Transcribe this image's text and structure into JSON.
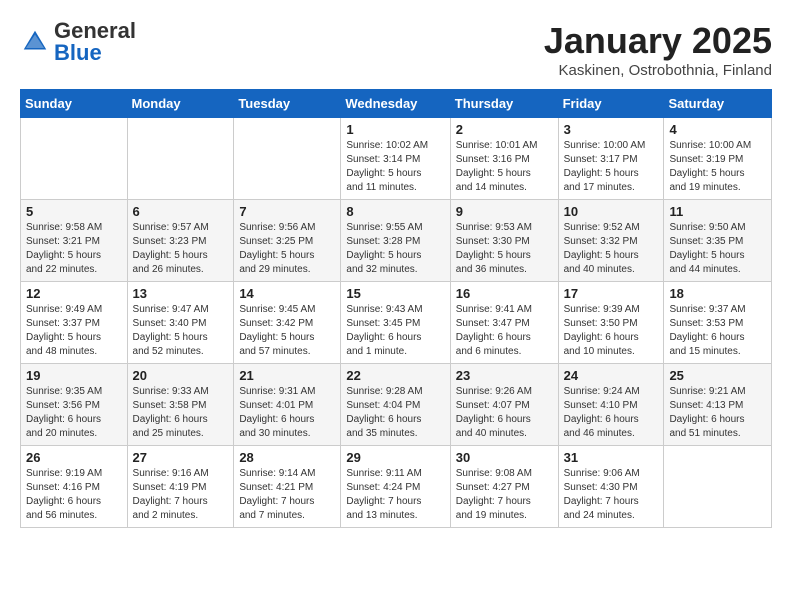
{
  "header": {
    "logo_general": "General",
    "logo_blue": "Blue",
    "month_title": "January 2025",
    "location": "Kaskinen, Ostrobothnia, Finland"
  },
  "days_of_week": [
    "Sunday",
    "Monday",
    "Tuesday",
    "Wednesday",
    "Thursday",
    "Friday",
    "Saturday"
  ],
  "weeks": [
    [
      {
        "day": "",
        "info": ""
      },
      {
        "day": "",
        "info": ""
      },
      {
        "day": "",
        "info": ""
      },
      {
        "day": "1",
        "info": "Sunrise: 10:02 AM\nSunset: 3:14 PM\nDaylight: 5 hours\nand 11 minutes."
      },
      {
        "day": "2",
        "info": "Sunrise: 10:01 AM\nSunset: 3:16 PM\nDaylight: 5 hours\nand 14 minutes."
      },
      {
        "day": "3",
        "info": "Sunrise: 10:00 AM\nSunset: 3:17 PM\nDaylight: 5 hours\nand 17 minutes."
      },
      {
        "day": "4",
        "info": "Sunrise: 10:00 AM\nSunset: 3:19 PM\nDaylight: 5 hours\nand 19 minutes."
      }
    ],
    [
      {
        "day": "5",
        "info": "Sunrise: 9:58 AM\nSunset: 3:21 PM\nDaylight: 5 hours\nand 22 minutes."
      },
      {
        "day": "6",
        "info": "Sunrise: 9:57 AM\nSunset: 3:23 PM\nDaylight: 5 hours\nand 26 minutes."
      },
      {
        "day": "7",
        "info": "Sunrise: 9:56 AM\nSunset: 3:25 PM\nDaylight: 5 hours\nand 29 minutes."
      },
      {
        "day": "8",
        "info": "Sunrise: 9:55 AM\nSunset: 3:28 PM\nDaylight: 5 hours\nand 32 minutes."
      },
      {
        "day": "9",
        "info": "Sunrise: 9:53 AM\nSunset: 3:30 PM\nDaylight: 5 hours\nand 36 minutes."
      },
      {
        "day": "10",
        "info": "Sunrise: 9:52 AM\nSunset: 3:32 PM\nDaylight: 5 hours\nand 40 minutes."
      },
      {
        "day": "11",
        "info": "Sunrise: 9:50 AM\nSunset: 3:35 PM\nDaylight: 5 hours\nand 44 minutes."
      }
    ],
    [
      {
        "day": "12",
        "info": "Sunrise: 9:49 AM\nSunset: 3:37 PM\nDaylight: 5 hours\nand 48 minutes."
      },
      {
        "day": "13",
        "info": "Sunrise: 9:47 AM\nSunset: 3:40 PM\nDaylight: 5 hours\nand 52 minutes."
      },
      {
        "day": "14",
        "info": "Sunrise: 9:45 AM\nSunset: 3:42 PM\nDaylight: 5 hours\nand 57 minutes."
      },
      {
        "day": "15",
        "info": "Sunrise: 9:43 AM\nSunset: 3:45 PM\nDaylight: 6 hours\nand 1 minute."
      },
      {
        "day": "16",
        "info": "Sunrise: 9:41 AM\nSunset: 3:47 PM\nDaylight: 6 hours\nand 6 minutes."
      },
      {
        "day": "17",
        "info": "Sunrise: 9:39 AM\nSunset: 3:50 PM\nDaylight: 6 hours\nand 10 minutes."
      },
      {
        "day": "18",
        "info": "Sunrise: 9:37 AM\nSunset: 3:53 PM\nDaylight: 6 hours\nand 15 minutes."
      }
    ],
    [
      {
        "day": "19",
        "info": "Sunrise: 9:35 AM\nSunset: 3:56 PM\nDaylight: 6 hours\nand 20 minutes."
      },
      {
        "day": "20",
        "info": "Sunrise: 9:33 AM\nSunset: 3:58 PM\nDaylight: 6 hours\nand 25 minutes."
      },
      {
        "day": "21",
        "info": "Sunrise: 9:31 AM\nSunset: 4:01 PM\nDaylight: 6 hours\nand 30 minutes."
      },
      {
        "day": "22",
        "info": "Sunrise: 9:28 AM\nSunset: 4:04 PM\nDaylight: 6 hours\nand 35 minutes."
      },
      {
        "day": "23",
        "info": "Sunrise: 9:26 AM\nSunset: 4:07 PM\nDaylight: 6 hours\nand 40 minutes."
      },
      {
        "day": "24",
        "info": "Sunrise: 9:24 AM\nSunset: 4:10 PM\nDaylight: 6 hours\nand 46 minutes."
      },
      {
        "day": "25",
        "info": "Sunrise: 9:21 AM\nSunset: 4:13 PM\nDaylight: 6 hours\nand 51 minutes."
      }
    ],
    [
      {
        "day": "26",
        "info": "Sunrise: 9:19 AM\nSunset: 4:16 PM\nDaylight: 6 hours\nand 56 minutes."
      },
      {
        "day": "27",
        "info": "Sunrise: 9:16 AM\nSunset: 4:19 PM\nDaylight: 7 hours\nand 2 minutes."
      },
      {
        "day": "28",
        "info": "Sunrise: 9:14 AM\nSunset: 4:21 PM\nDaylight: 7 hours\nand 7 minutes."
      },
      {
        "day": "29",
        "info": "Sunrise: 9:11 AM\nSunset: 4:24 PM\nDaylight: 7 hours\nand 13 minutes."
      },
      {
        "day": "30",
        "info": "Sunrise: 9:08 AM\nSunset: 4:27 PM\nDaylight: 7 hours\nand 19 minutes."
      },
      {
        "day": "31",
        "info": "Sunrise: 9:06 AM\nSunset: 4:30 PM\nDaylight: 7 hours\nand 24 minutes."
      },
      {
        "day": "",
        "info": ""
      }
    ]
  ]
}
